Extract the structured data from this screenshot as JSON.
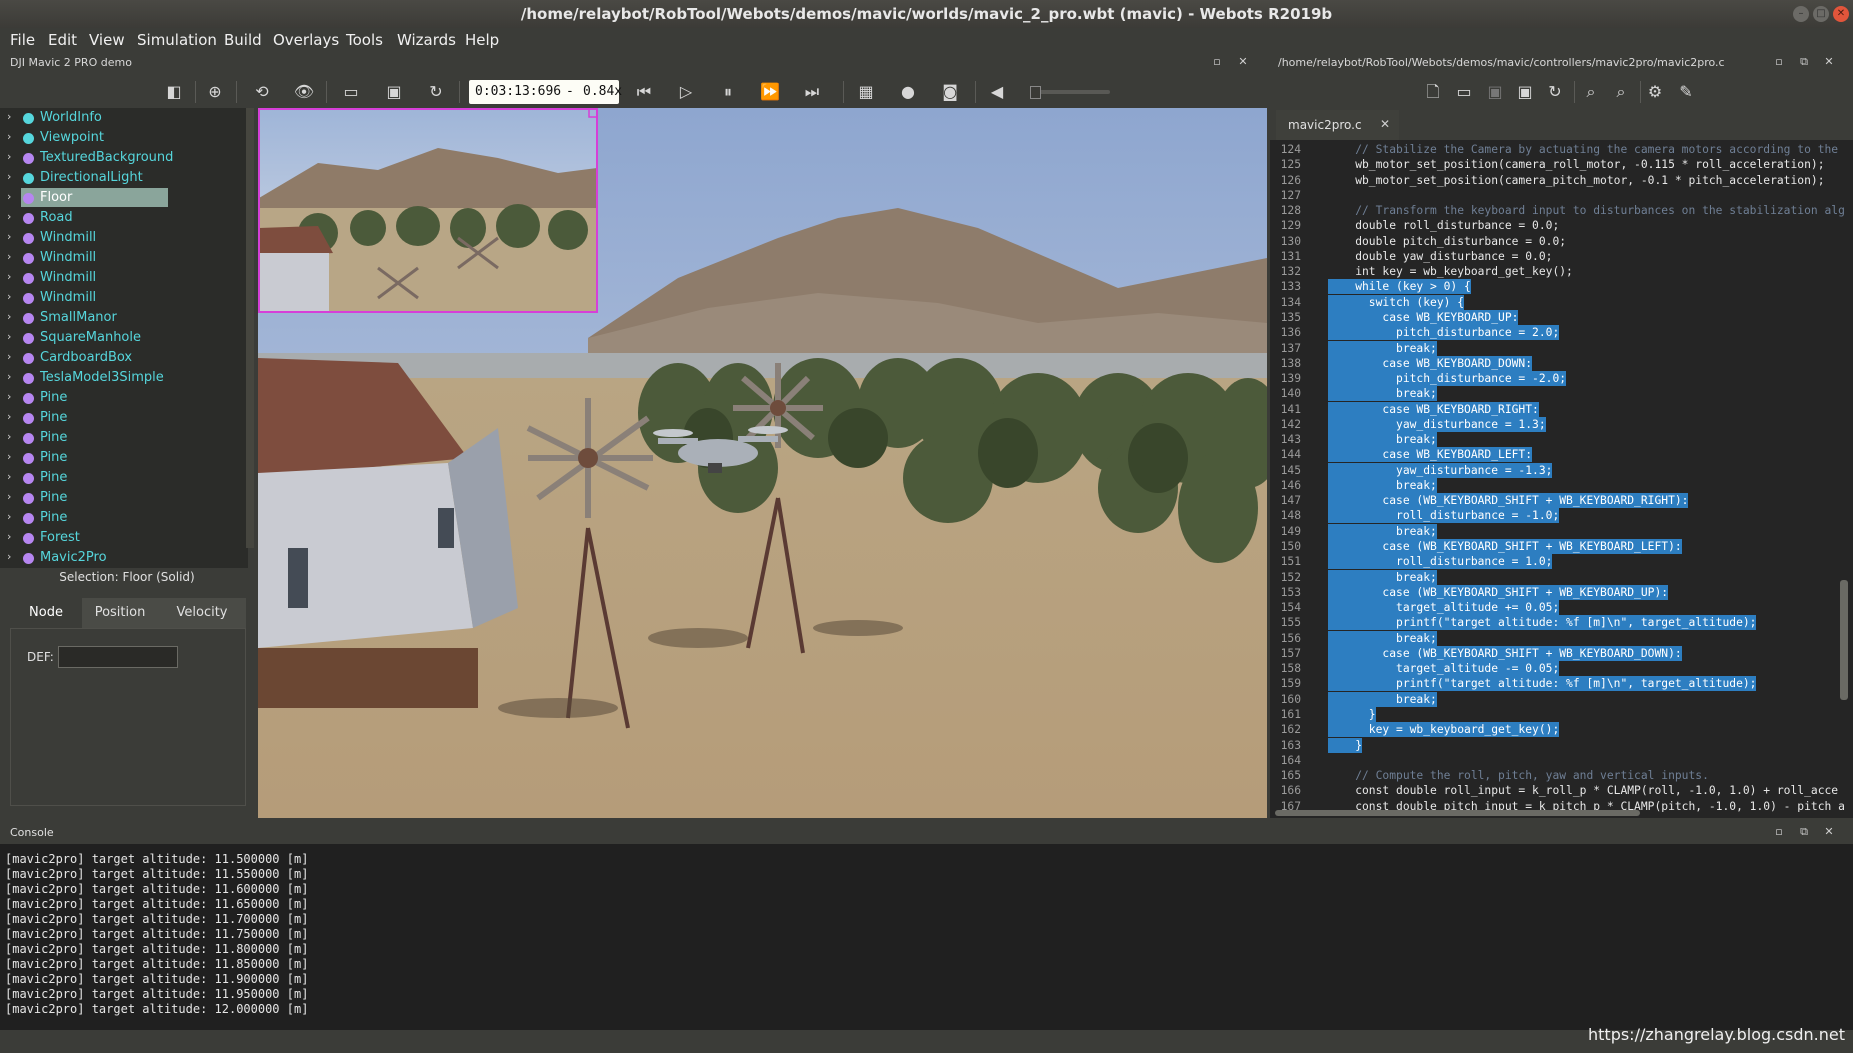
{
  "window": {
    "title": "/home/relaybot/RobTool/Webots/demos/mavic/worlds/mavic_2_pro.wbt (mavic) - Webots R2019b"
  },
  "menu": [
    "File",
    "Edit",
    "View",
    "Simulation",
    "Build",
    "Overlays",
    "Tools",
    "Wizards",
    "Help"
  ],
  "scene_panel": {
    "title": "DJI Mavic 2 PRO demo"
  },
  "editor_panel": {
    "path": "/home/relaybot/RobTool/Webots/demos/mavic/controllers/mavic2pro/mavic2pro.c"
  },
  "toolbar": {
    "time": "0:03:13:696",
    "separator": "-",
    "speed": "0.84x",
    "icons": [
      "toggle-scene-tree-icon",
      "add-node-icon",
      "reset-view-icon",
      "view-icon",
      "open-world-icon",
      "save-world-icon",
      "reload-world-icon",
      "step-back-icon",
      "step-icon",
      "pause-icon",
      "fast-forward-icon",
      "fastest-icon",
      "record-movie-icon",
      "record-animation-icon",
      "screenshot-icon",
      "mute-icon"
    ],
    "editor_icons": [
      "new-file-icon",
      "open-file-icon",
      "save-icon",
      "save-all-icon",
      "revert-icon",
      "find-icon",
      "replace-icon",
      "build-icon",
      "clean-icon"
    ]
  },
  "colors": {
    "node_cyan": "#56d6dc",
    "node_purple": "#b686f0",
    "selection_highlight": "#8aa59b",
    "code_selection": "#2d7ec1",
    "overlay_border": "#d63fd8"
  },
  "tree": {
    "items": [
      {
        "label": "WorldInfo",
        "color": "cyan"
      },
      {
        "label": "Viewpoint",
        "color": "cyan"
      },
      {
        "label": "TexturedBackground",
        "color": "purple"
      },
      {
        "label": "DirectionalLight",
        "color": "cyan"
      },
      {
        "label": "Floor",
        "color": "purple",
        "selected": true
      },
      {
        "label": "Road",
        "color": "purple"
      },
      {
        "label": "Windmill",
        "color": "purple"
      },
      {
        "label": "Windmill",
        "color": "purple"
      },
      {
        "label": "Windmill",
        "color": "purple"
      },
      {
        "label": "Windmill",
        "color": "purple"
      },
      {
        "label": "SmallManor",
        "color": "purple"
      },
      {
        "label": "SquareManhole",
        "color": "purple"
      },
      {
        "label": "CardboardBox",
        "color": "purple"
      },
      {
        "label": "TeslaModel3Simple",
        "color": "purple"
      },
      {
        "label": "Pine",
        "color": "purple"
      },
      {
        "label": "Pine",
        "color": "purple"
      },
      {
        "label": "Pine",
        "color": "purple"
      },
      {
        "label": "Pine",
        "color": "purple"
      },
      {
        "label": "Pine",
        "color": "purple"
      },
      {
        "label": "Pine",
        "color": "purple"
      },
      {
        "label": "Pine",
        "color": "purple"
      },
      {
        "label": "Forest",
        "color": "purple"
      },
      {
        "label": "Mavic2Pro",
        "color": "purple"
      }
    ]
  },
  "selection": {
    "label": "Selection: Floor (Solid)",
    "tabs": [
      "Node",
      "Position",
      "Velocity"
    ],
    "active_tab": "Node",
    "def_label": "DEF:",
    "def_value": ""
  },
  "editor": {
    "tab": "mavic2pro.c",
    "lines": [
      {
        "n": "124",
        "t": "    // Stabilize the Camera by actuating the camera motors according to the",
        "hl": false
      },
      {
        "n": "125",
        "t": "    wb_motor_set_position(camera_roll_motor, -0.115 * roll_acceleration);",
        "hl": false
      },
      {
        "n": "126",
        "t": "    wb_motor_set_position(camera_pitch_motor, -0.1 * pitch_acceleration);",
        "hl": false
      },
      {
        "n": "127",
        "t": "",
        "hl": false
      },
      {
        "n": "128",
        "t": "    // Transform the keyboard input to disturbances on the stabilization alg",
        "hl": false
      },
      {
        "n": "129",
        "t": "    double roll_disturbance = 0.0;",
        "hl": false
      },
      {
        "n": "130",
        "t": "    double pitch_disturbance = 0.0;",
        "hl": false
      },
      {
        "n": "131",
        "t": "    double yaw_disturbance = 0.0;",
        "hl": false
      },
      {
        "n": "132",
        "t": "    int key = wb_keyboard_get_key();",
        "hl": false
      },
      {
        "n": "133",
        "t": "    while (key > 0) {",
        "hl": true
      },
      {
        "n": "134",
        "t": "      switch (key) {",
        "hl": true
      },
      {
        "n": "135",
        "t": "        case WB_KEYBOARD_UP:",
        "hl": true
      },
      {
        "n": "136",
        "t": "          pitch_disturbance = 2.0;",
        "hl": true
      },
      {
        "n": "137",
        "t": "          break;",
        "hl": true
      },
      {
        "n": "138",
        "t": "        case WB_KEYBOARD_DOWN:",
        "hl": true
      },
      {
        "n": "139",
        "t": "          pitch_disturbance = -2.0;",
        "hl": true
      },
      {
        "n": "140",
        "t": "          break;",
        "hl": true
      },
      {
        "n": "141",
        "t": "        case WB_KEYBOARD_RIGHT:",
        "hl": true
      },
      {
        "n": "142",
        "t": "          yaw_disturbance = 1.3;",
        "hl": true
      },
      {
        "n": "143",
        "t": "          break;",
        "hl": true
      },
      {
        "n": "144",
        "t": "        case WB_KEYBOARD_LEFT:",
        "hl": true
      },
      {
        "n": "145",
        "t": "          yaw_disturbance = -1.3;",
        "hl": true
      },
      {
        "n": "146",
        "t": "          break;",
        "hl": true
      },
      {
        "n": "147",
        "t": "        case (WB_KEYBOARD_SHIFT + WB_KEYBOARD_RIGHT):",
        "hl": true
      },
      {
        "n": "148",
        "t": "          roll_disturbance = -1.0;",
        "hl": true
      },
      {
        "n": "149",
        "t": "          break;",
        "hl": true
      },
      {
        "n": "150",
        "t": "        case (WB_KEYBOARD_SHIFT + WB_KEYBOARD_LEFT):",
        "hl": true
      },
      {
        "n": "151",
        "t": "          roll_disturbance = 1.0;",
        "hl": true
      },
      {
        "n": "152",
        "t": "          break;",
        "hl": true
      },
      {
        "n": "153",
        "t": "        case (WB_KEYBOARD_SHIFT + WB_KEYBOARD_UP):",
        "hl": true
      },
      {
        "n": "154",
        "t": "          target_altitude += 0.05;",
        "hl": true
      },
      {
        "n": "155",
        "t": "          printf(\"target altitude: %f [m]\\n\", target_altitude);",
        "hl": true
      },
      {
        "n": "156",
        "t": "          break;",
        "hl": true
      },
      {
        "n": "157",
        "t": "        case (WB_KEYBOARD_SHIFT + WB_KEYBOARD_DOWN):",
        "hl": true
      },
      {
        "n": "158",
        "t": "          target_altitude -= 0.05;",
        "hl": true
      },
      {
        "n": "159",
        "t": "          printf(\"target altitude: %f [m]\\n\", target_altitude);",
        "hl": true
      },
      {
        "n": "160",
        "t": "          break;",
        "hl": true
      },
      {
        "n": "161",
        "t": "      }",
        "hl": true
      },
      {
        "n": "162",
        "t": "      key = wb_keyboard_get_key();",
        "hl": true
      },
      {
        "n": "163",
        "t": "    }",
        "hl": true
      },
      {
        "n": "164",
        "t": "",
        "hl": false
      },
      {
        "n": "165",
        "t": "    // Compute the roll, pitch, yaw and vertical inputs.",
        "hl": false
      },
      {
        "n": "166",
        "t": "    const double roll_input = k_roll_p * CLAMP(roll, -1.0, 1.0) + roll_acce",
        "hl": false
      },
      {
        "n": "167",
        "t": "    const double pitch_input = k_pitch_p * CLAMP(pitch, -1.0, 1.0) - pitch_a",
        "hl": false
      }
    ]
  },
  "console": {
    "title": "Console",
    "lines": [
      "[mavic2pro] target altitude: 11.500000 [m]",
      "[mavic2pro] target altitude: 11.550000 [m]",
      "[mavic2pro] target altitude: 11.600000 [m]",
      "[mavic2pro] target altitude: 11.650000 [m]",
      "[mavic2pro] target altitude: 11.700000 [m]",
      "[mavic2pro] target altitude: 11.750000 [m]",
      "[mavic2pro] target altitude: 11.800000 [m]",
      "[mavic2pro] target altitude: 11.850000 [m]",
      "[mavic2pro] target altitude: 11.900000 [m]",
      "[mavic2pro] target altitude: 11.950000 [m]",
      "[mavic2pro] target altitude: 12.000000 [m]"
    ]
  },
  "watermark": "https://zhangrelay.blog.csdn.net"
}
